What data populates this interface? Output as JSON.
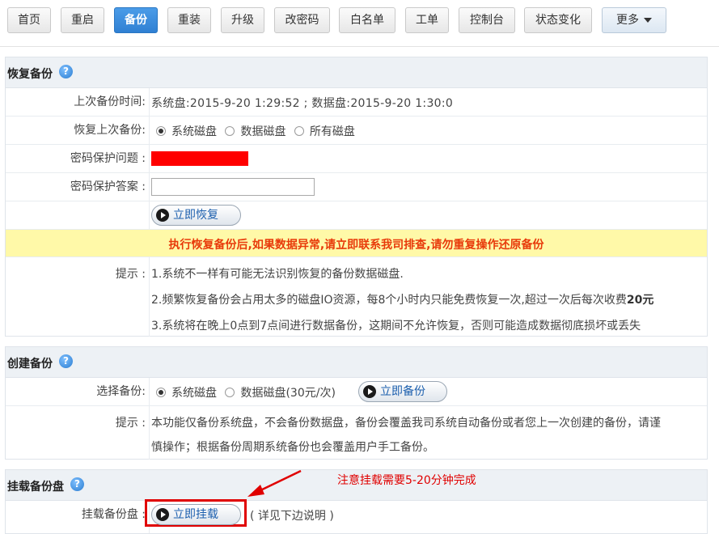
{
  "nav": {
    "items": [
      "首页",
      "重启",
      "备份",
      "重装",
      "升级",
      "改密码",
      "白名单",
      "工单",
      "控制台",
      "状态变化"
    ],
    "active_index": 2,
    "more_label": "更多"
  },
  "restore": {
    "title": "恢复备份",
    "last_backup_label": "上次备份时间:",
    "last_backup_value": "系统盘:2015-9-20 1:29:52 ; 数据盘:2015-9-20 1:30:0",
    "restore_last_label": "恢复上次备份:",
    "options": [
      "系统磁盘",
      "数据磁盘",
      "所有磁盘"
    ],
    "selected_option": 0,
    "question_label": "密码保护问题 :",
    "answer_label": "密码保护答案 :",
    "answer_value": "",
    "button_label": "立即恢复",
    "warning": "执行恢复备份后,如果数据异常,请立即联系我司排查,请勿重复操作还原备份",
    "tip_label": "提示 :",
    "tips": [
      "1.系统不一样有可能无法识别恢复的备份数据磁盘.",
      "2.频繁恢复备份会占用太多的磁盘IO资源，每8个小时内只能免费恢复一次,超过一次后每次收费",
      "3.系统将在晚上0点到7点间进行数据备份，这期间不允许恢复，否则可能造成数据彻底损坏或丢失"
    ],
    "fee_amount": "20元"
  },
  "create": {
    "title": "创建备份",
    "select_label": "选择备份:",
    "options": [
      "系统磁盘",
      "数据磁盘(30元/次)"
    ],
    "selected_option": 0,
    "button_label": "立即备份",
    "tip_label": "提示 :",
    "tip_line1": "本功能仅备份系统盘，不会备份数据盘，备份会覆盖我司系统自动备份或者您上一次创建的备份，请谨",
    "tip_line2": "慎操作；根据备份周期系统备份也会覆盖用户手工备份。"
  },
  "mount": {
    "title": "挂载备份盘",
    "label": "挂载备份盘 :",
    "button_label": "立即挂载",
    "note": "( 详见下边说明 )",
    "annotation": "注意挂载需要5-20分钟完成"
  },
  "colors": {
    "accent": "#3a8de0",
    "warning_bg": "#fff9a8",
    "warning_text": "#e83a0a",
    "annotation": "#e00000",
    "link": "#1c5fae"
  },
  "icons": {
    "help": "question-circle-icon",
    "play": "play-circle-icon",
    "caret": "caret-down-icon",
    "arrow": "red-arrow-icon"
  }
}
